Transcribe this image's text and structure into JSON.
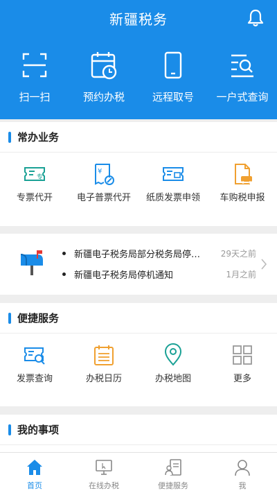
{
  "header": {
    "title": "新疆税务",
    "bell_icon": "bell-icon",
    "quick_actions": [
      {
        "label": "扫一扫",
        "icon": "scan-icon"
      },
      {
        "label": "预约办税",
        "icon": "calendar-clock-icon"
      },
      {
        "label": "远程取号",
        "icon": "phone-icon"
      },
      {
        "label": "一户式查询",
        "icon": "list-search-icon"
      }
    ]
  },
  "common_business": {
    "title": "常办业务",
    "items": [
      {
        "label": "专票代开",
        "icon": "special-invoice-icon"
      },
      {
        "label": "电子普票代开",
        "icon": "e-invoice-icon"
      },
      {
        "label": "纸质发票申领",
        "icon": "paper-invoice-icon"
      },
      {
        "label": "车购税申报",
        "icon": "vehicle-tax-icon"
      }
    ]
  },
  "notices": {
    "icon": "mailbox-icon",
    "items": [
      {
        "text": "新疆电子税务局部分税务局停机通知",
        "time": "29天之前"
      },
      {
        "text": "新疆电子税务局停机通知",
        "time": "1月之前"
      }
    ]
  },
  "quick_services": {
    "title": "便捷服务",
    "items": [
      {
        "label": "发票查询",
        "icon": "invoice-search-icon"
      },
      {
        "label": "办税日历",
        "icon": "tax-calendar-icon"
      },
      {
        "label": "办税地图",
        "icon": "map-pin-icon"
      },
      {
        "label": "更多",
        "icon": "grid-more-icon"
      }
    ]
  },
  "my_items": {
    "title": "我的事项"
  },
  "tabbar": {
    "tabs": [
      {
        "label": "首页",
        "icon": "home-icon",
        "active": true
      },
      {
        "label": "在线办税",
        "icon": "monitor-icon",
        "active": false
      },
      {
        "label": "便捷服务",
        "icon": "service-icon",
        "active": false
      },
      {
        "label": "我",
        "icon": "user-icon",
        "active": false
      }
    ]
  },
  "colors": {
    "primary": "#1a8ce8",
    "green": "#1aa195",
    "orange": "#f0a030",
    "gray": "#999999"
  }
}
